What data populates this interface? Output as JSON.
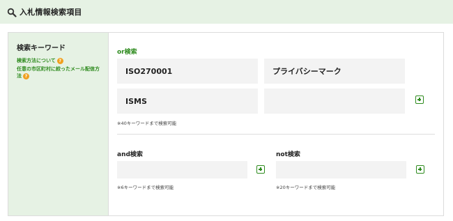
{
  "header": {
    "title": "入札情報検索項目",
    "icon": "search-icon"
  },
  "sidebar": {
    "label": "検索キーワード",
    "links": [
      {
        "label": "検索方法について"
      },
      {
        "label": "任意の市区町村に絞ったメール配信方法"
      }
    ],
    "help_glyph": "?"
  },
  "or_search": {
    "title": "or検索",
    "fields": [
      {
        "value": "ISO270001"
      },
      {
        "value": "プライバシーマーク"
      },
      {
        "value": "ISMS"
      },
      {
        "value": ""
      }
    ],
    "note": "※40キーワードまで検索可能"
  },
  "and_search": {
    "title": "and検索",
    "value": "",
    "note": "※6キーワードまで検索可能"
  },
  "not_search": {
    "title": "not検索",
    "value": "",
    "note": "※20キーワードまで検索可能"
  },
  "colors": {
    "accent": "#2e8b1e",
    "header_bg": "#e6f2e4",
    "field_bg": "#f3f3f3",
    "help_badge": "#f0a020"
  }
}
